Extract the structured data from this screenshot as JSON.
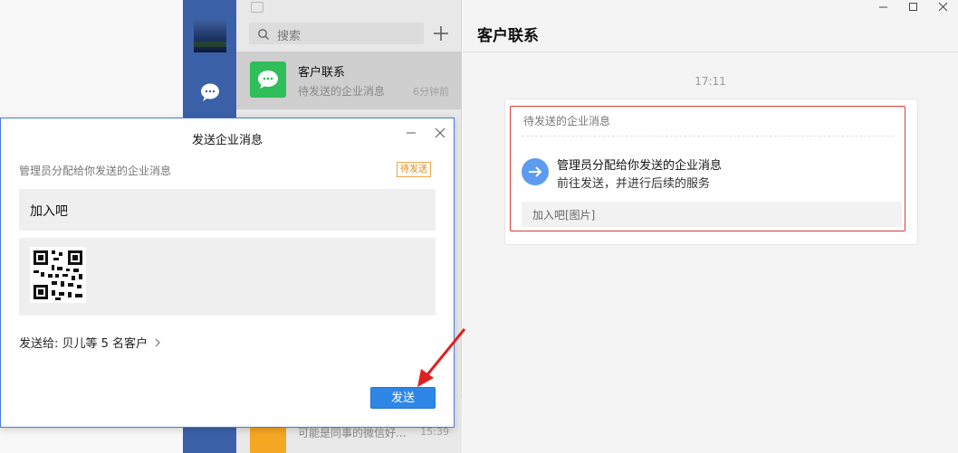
{
  "conversation_list": {
    "search_placeholder": "搜索",
    "items": [
      {
        "title": "客户联系",
        "subtitle": "待发送的企业消息",
        "time": "6分钟前"
      },
      {
        "title": "",
        "subtitle": "可能是同事的微信好...",
        "time": "15:39"
      }
    ]
  },
  "chat": {
    "title": "客户联系",
    "timestamp": "17:11",
    "card": {
      "label": "待发送的企业消息",
      "heading": "管理员分配给你发送的企业消息",
      "description": "前往发送，并进行后续的服务",
      "footer": "加入吧[图片]"
    }
  },
  "dialog": {
    "title": "发送企业消息",
    "subtitle": "管理员分配给你发送的企业消息",
    "badge": "待发送",
    "message_text": "加入吧",
    "recipients": "发送给: 贝儿等 5 名客户",
    "send_label": "发送"
  },
  "colors": {
    "sidebar": "#3a61a8",
    "accent_blue": "#2e86e6",
    "highlight_red": "#d83a3a",
    "badge_orange": "#f0a64a",
    "wechat_green": "#2fbe5a"
  },
  "icons": [
    "chat-bubble-icon",
    "search-icon",
    "plus-icon",
    "wechat-icon",
    "arrow-right-icon",
    "minimize-icon",
    "maximize-icon",
    "close-icon",
    "chevron-right-icon"
  ]
}
